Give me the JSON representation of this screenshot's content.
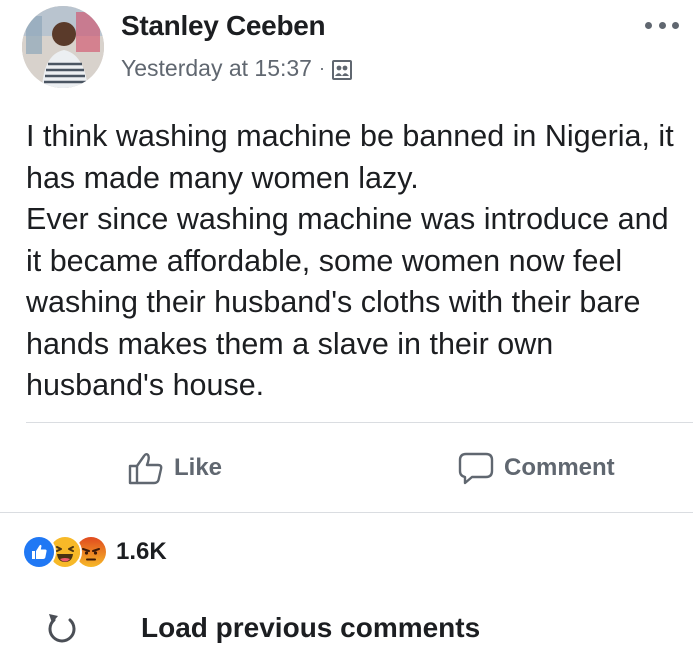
{
  "post": {
    "author": "Stanley Ceeben",
    "timestamp": "Yesterday at 15:37",
    "separator": "·",
    "privacy_icon": "friends-icon",
    "body": [
      "I think washing machine be banned in Nigeria, it has made many women lazy.",
      "Ever since washing machine was introduce and it became affordable, some women now feel washing their husband's cloths with their bare hands makes them a slave in their own husband's house."
    ]
  },
  "actions": {
    "like_label": "Like",
    "comment_label": "Comment"
  },
  "reactions": {
    "types": [
      "like",
      "haha",
      "angry"
    ],
    "count": "1.6K"
  },
  "comments": {
    "load_previous_label": "Load previous comments"
  },
  "colors": {
    "text": "#1c1e21",
    "secondary_text": "#606770",
    "like_blue": "#2078f4",
    "haha_yellow": "#f7b928",
    "angry_orange": "#e9710f",
    "divider": "#dadde1"
  }
}
